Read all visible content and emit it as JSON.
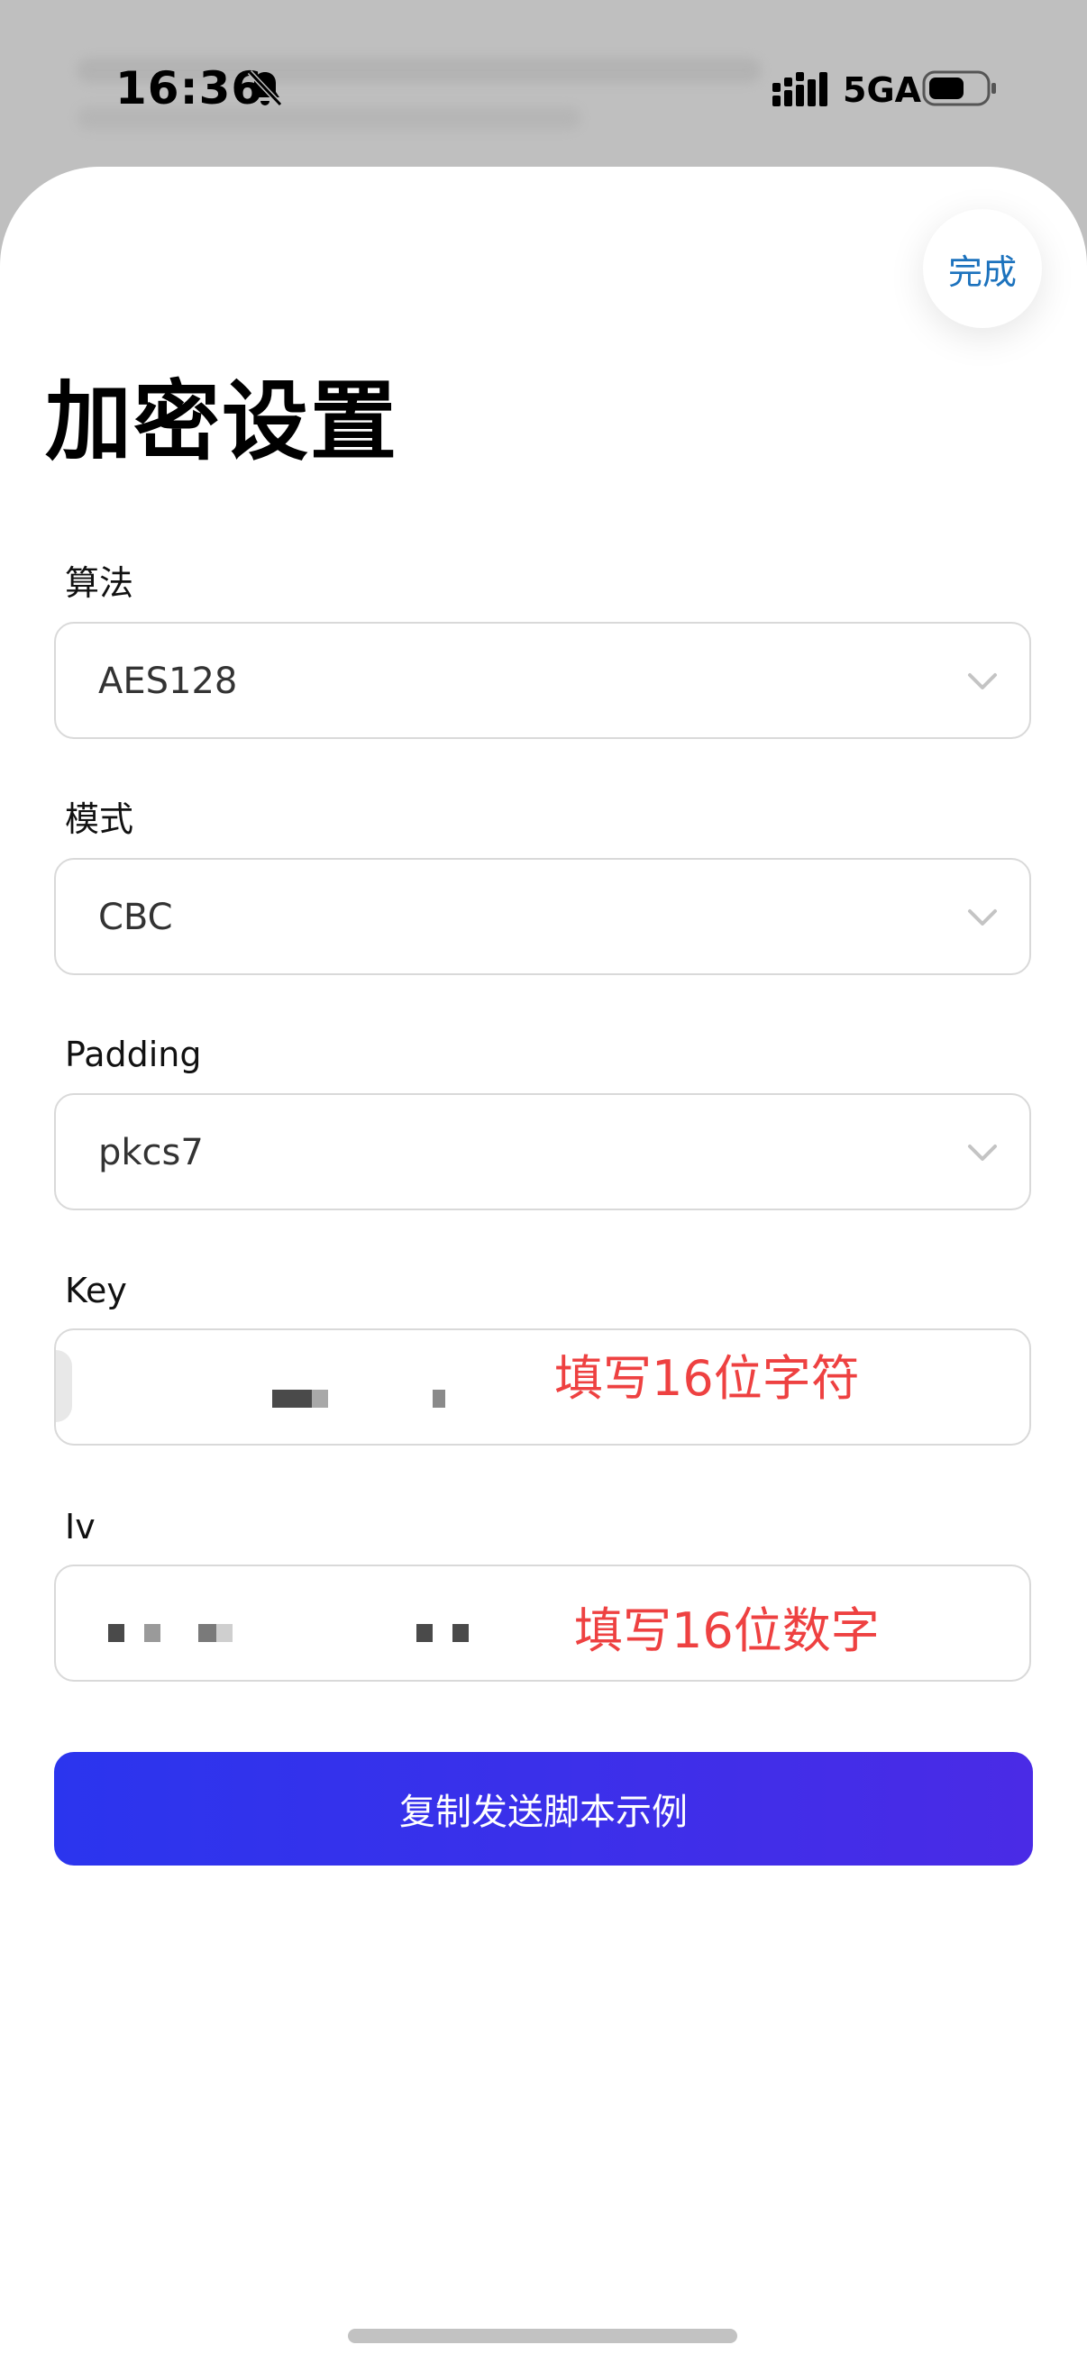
{
  "status_bar": {
    "time": "16:36",
    "network": "5GA"
  },
  "header": {
    "done_label": "完成",
    "title": "加密设置"
  },
  "form": {
    "algorithm": {
      "label": "算法",
      "value": "AES128"
    },
    "mode": {
      "label": "模式",
      "value": "CBC"
    },
    "padding": {
      "label": "Padding",
      "value": "pkcs7"
    },
    "key": {
      "label": "Key",
      "hint": "填写16位字符"
    },
    "iv": {
      "label": "Iv",
      "hint": "填写16位数字"
    }
  },
  "actions": {
    "copy_script_label": "复制发送脚本示例"
  },
  "colors": {
    "accent": "#1c72bd",
    "hint": "#ee4141",
    "button_start": "#2b35ee",
    "button_end": "#4a2be6"
  },
  "icons": {
    "bell": "bell-slash-icon",
    "signal": "signal-icon",
    "battery": "battery-icon",
    "chevron": "chevron-down-icon"
  }
}
